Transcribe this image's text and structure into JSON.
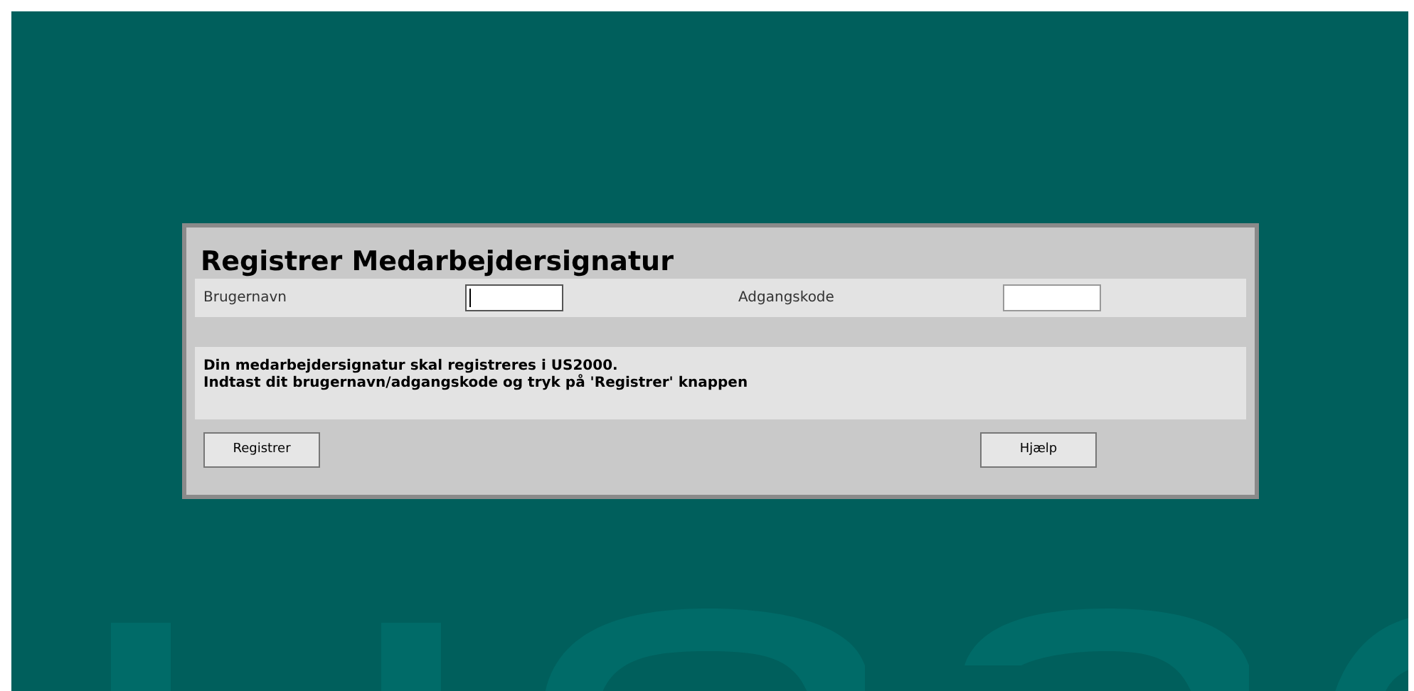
{
  "dialog": {
    "title": "Registrer Medarbejdersignatur",
    "fields": [
      {
        "label": "Brugernavn",
        "focused": true
      },
      {
        "label": "Adgangskode",
        "focused": false
      }
    ],
    "message": [
      "Din medarbejdersignatur skal registreres i US2000.",
      "Indtast dit brugernavn/adgangskode og tryk på 'Registrer' knappen"
    ],
    "buttons": [
      "Registrer",
      "Hjælp"
    ]
  }
}
